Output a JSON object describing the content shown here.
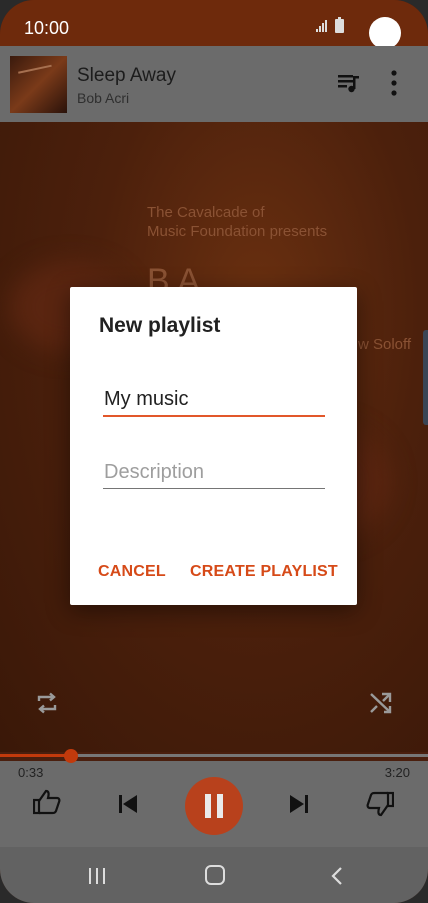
{
  "status_bar": {
    "time": "10:00"
  },
  "now_playing": {
    "title": "Sleep Away",
    "artist": "Bob Acri"
  },
  "album_art_text": {
    "line1": "The Cavalcade of",
    "line2": "Music Foundation presents",
    "line3": "B   A",
    "line4": "w Soloff"
  },
  "progress": {
    "elapsed": "0:33",
    "total": "3:20",
    "fraction": 0.165
  },
  "dialog": {
    "title": "New playlist",
    "name_value": "My music",
    "description_placeholder": "Description",
    "cancel_label": "CANCEL",
    "create_label": "CREATE PLAYLIST"
  },
  "colors": {
    "accent": "#d64a18",
    "status_bar": "#6e2a0c",
    "play_button": "#b8411c"
  },
  "icons": [
    "signal-icon",
    "battery-icon",
    "queue-music-icon",
    "more-vert-icon",
    "repeat-icon",
    "shuffle-icon",
    "thumb-up-icon",
    "skip-previous-icon",
    "pause-icon",
    "skip-next-icon",
    "thumb-down-icon",
    "nav-recents-icon",
    "nav-home-icon",
    "nav-back-icon"
  ]
}
